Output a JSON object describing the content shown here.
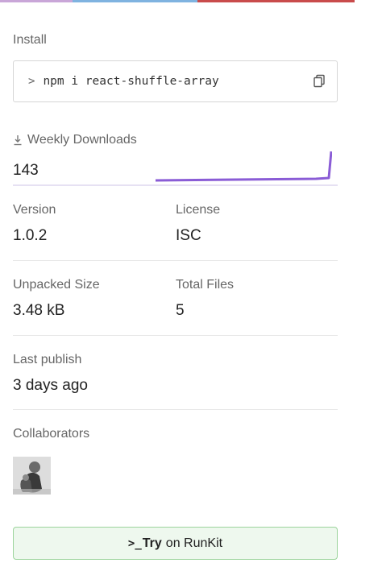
{
  "colors": {
    "sparkline": "#8a5cd6",
    "runkit_bg": "#eef8ee",
    "runkit_border": "#9bd49b"
  },
  "install": {
    "label": "Install",
    "chevron": ">",
    "command": "npm i react-shuffle-array",
    "copy_icon": "copy-icon"
  },
  "downloads": {
    "label": "Weekly Downloads",
    "value": "143",
    "icon": "download-icon"
  },
  "version": {
    "label": "Version",
    "value": "1.0.2"
  },
  "license": {
    "label": "License",
    "value": "ISC"
  },
  "unpacked_size": {
    "label": "Unpacked Size",
    "value": "3.48 kB"
  },
  "total_files": {
    "label": "Total Files",
    "value": "5"
  },
  "last_publish": {
    "label": "Last publish",
    "value": "3 days ago"
  },
  "collaborators": {
    "label": "Collaborators"
  },
  "runkit": {
    "prompt": ">_",
    "bold": "Try",
    "rest": "on RunKit"
  }
}
